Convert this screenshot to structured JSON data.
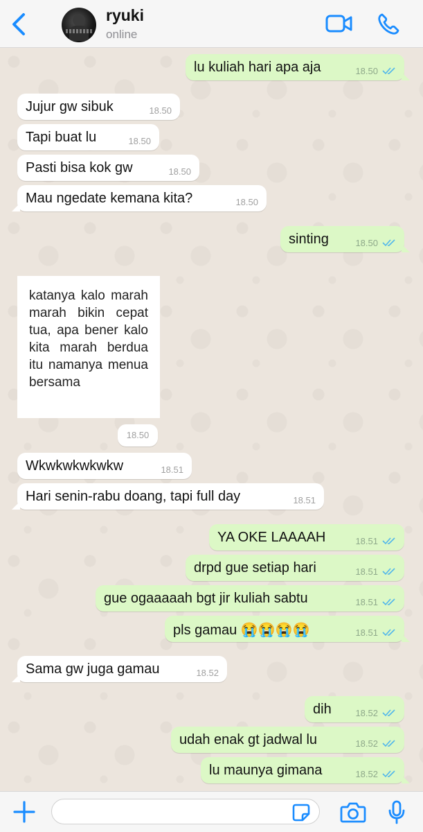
{
  "header": {
    "contact_name": "ryuki",
    "contact_status": "online",
    "icons": [
      "back-chevron-icon",
      "video-call-icon",
      "phone-call-icon"
    ]
  },
  "colors": {
    "accent": "#1a8cff",
    "outgoing_bubble": "#dcf8c6",
    "incoming_bubble": "#ffffff",
    "read_ticks": "#4fb6ec",
    "chat_background": "#ece5dd"
  },
  "messages": [
    {
      "direction": "out",
      "text": "lu kuliah hari apa aja",
      "time": "18.50",
      "read": true
    },
    {
      "direction": "in",
      "text": "Jujur gw sibuk",
      "time": "18.50"
    },
    {
      "direction": "in",
      "text": "Tapi buat lu",
      "time": "18.50"
    },
    {
      "direction": "in",
      "text": "Pasti bisa kok gw",
      "time": "18.50"
    },
    {
      "direction": "in",
      "text": "Mau ngedate kemana kita?",
      "time": "18.50"
    },
    {
      "direction": "out",
      "text": "sinting",
      "time": "18.50",
      "read": true
    },
    {
      "direction": "in",
      "type": "image",
      "image_text": "katanya kalo marah marah bikin cepat tua, apa bener kalo kita marah berdua itu namanya menua bersama",
      "time": "18.50"
    },
    {
      "direction": "in",
      "text": "Wkwkwkwkwkw",
      "time": "18.51"
    },
    {
      "direction": "in",
      "text": "Hari senin-rabu doang, tapi full day",
      "time": "18.51"
    },
    {
      "direction": "out",
      "text": "YA OKE LAAAAH",
      "time": "18.51",
      "read": true
    },
    {
      "direction": "out",
      "text": "drpd gue setiap hari",
      "time": "18.51",
      "read": true
    },
    {
      "direction": "out",
      "text": "gue ogaaaaah bgt jir kuliah sabtu",
      "time": "18.51",
      "read": true
    },
    {
      "direction": "out",
      "text": "pls gamau 😭😭😭😭",
      "time": "18.51",
      "read": true
    },
    {
      "direction": "in",
      "text": "Sama gw juga gamau",
      "time": "18.52"
    },
    {
      "direction": "out",
      "text": "dih",
      "time": "18.52",
      "read": true
    },
    {
      "direction": "out",
      "text": "udah enak gt jadwal lu",
      "time": "18.52",
      "read": true
    },
    {
      "direction": "out",
      "text": "lu maunya gimana",
      "time": "18.52",
      "read": true
    }
  ],
  "input_bar": {
    "message_value": "",
    "icons": [
      "plus-icon",
      "sticker-icon",
      "camera-icon",
      "microphone-icon"
    ]
  }
}
